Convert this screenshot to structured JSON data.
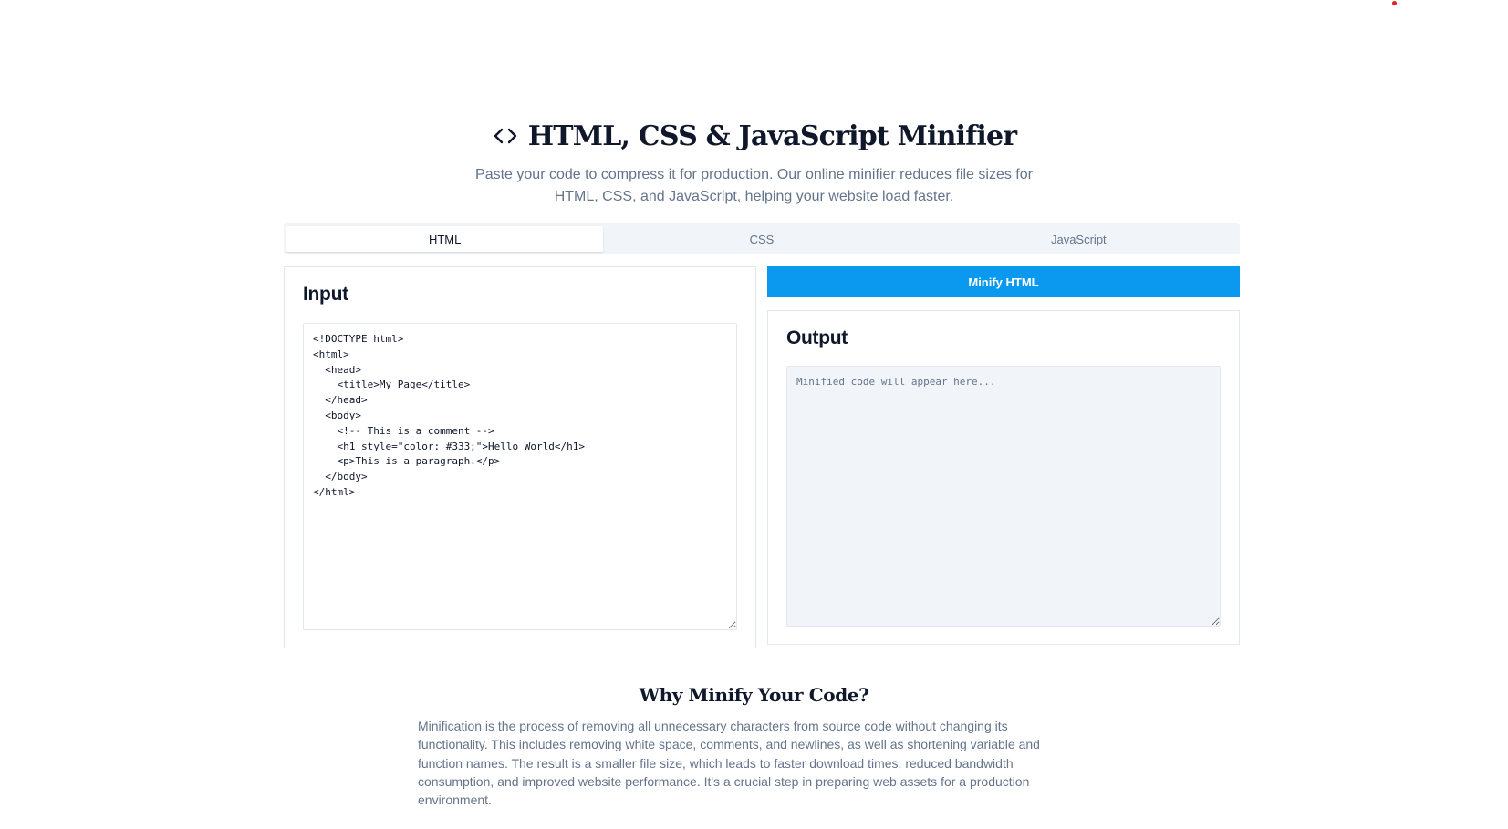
{
  "header": {
    "title_icon": "code-brackets-icon",
    "title": "HTML, CSS & JavaScript Minifier",
    "subtitle": "Paste your code to compress it for production. Our online minifier reduces file sizes for HTML, CSS, and JavaScript, helping your website load faster."
  },
  "tabs": [
    {
      "label": "HTML",
      "active": true
    },
    {
      "label": "CSS",
      "active": false
    },
    {
      "label": "JavaScript",
      "active": false
    }
  ],
  "input_panel": {
    "title": "Input",
    "code": "<!DOCTYPE html>\n<html>\n  <head>\n    <title>My Page</title>\n  </head>\n  <body>\n    <!-- This is a comment -->\n    <h1 style=\"color: #333;\">Hello World</h1>\n    <p>This is a paragraph.</p>\n  </body>\n</html>"
  },
  "minify_button": {
    "label": "Minify HTML"
  },
  "output_panel": {
    "title": "Output",
    "value": "",
    "placeholder": "Minified code will appear here..."
  },
  "why_section": {
    "title": "Why Minify Your Code?",
    "text": "Minification is the process of removing all unnecessary characters from source code without changing its functionality. This includes removing white space, comments, and newlines, as well as shortening variable and function names. The result is a smaller file size, which leads to faster download times, reduced bandwidth consumption, and improved website performance. It's a crucial step in preparing web assets for a production environment."
  },
  "colors": {
    "accent": "#0b99f0",
    "text_primary": "#0f172a",
    "text_muted": "#64748b",
    "tabs_background": "#f1f5f9",
    "border": "#e2e8f0",
    "indicator_dot": "#dc2626"
  }
}
